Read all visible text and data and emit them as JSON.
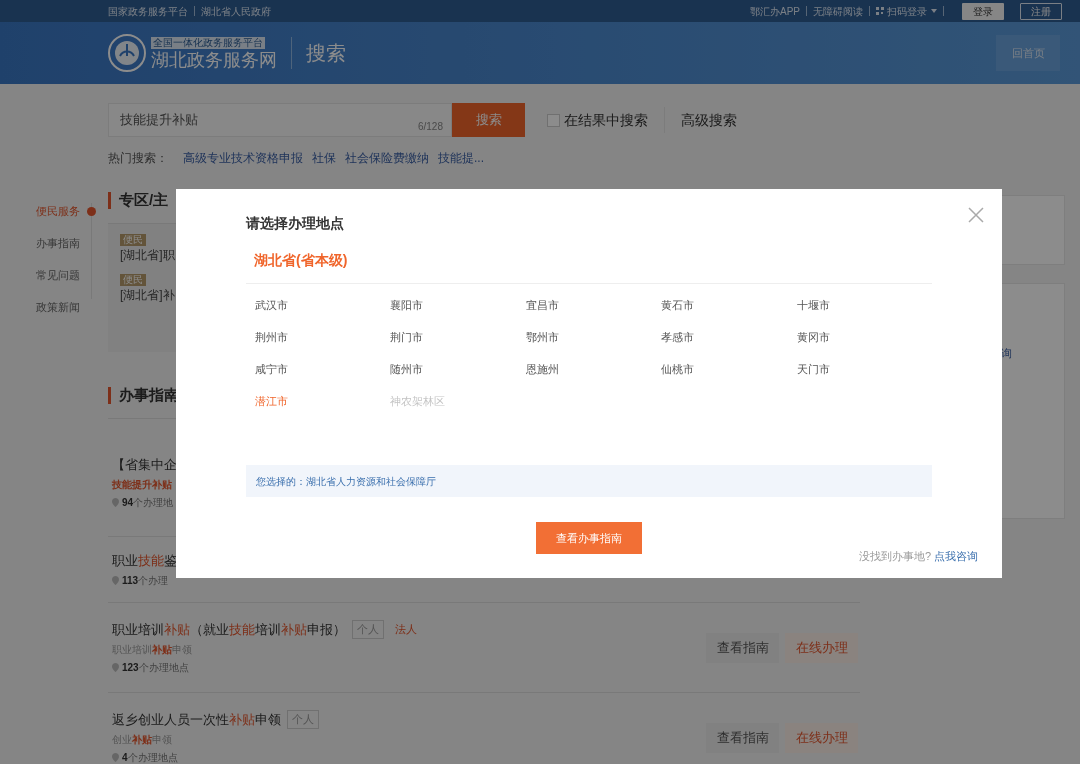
{
  "top_bar": {
    "left_links": [
      "国家政务服务平台",
      "湖北省人民政府"
    ],
    "right_links": [
      "鄂汇办APP",
      "无障碍阅读"
    ],
    "scan_login": "扫码登录",
    "login": "登录",
    "register": "注册"
  },
  "header": {
    "logo_tagline": "全国一体化政务服务平台",
    "logo_title": "湖北政务服务网",
    "page_title": "搜索",
    "home_button": "回首页"
  },
  "search": {
    "value": "技能提升补贴",
    "counter": "6/128",
    "button": "搜索",
    "in_results": {
      "label": "在结果中搜索",
      "checked": false
    },
    "advanced": "高级搜索"
  },
  "hot_search": {
    "label": "热门搜索：",
    "items": [
      "高级专业技术资格申报",
      "社保",
      "社会保险费缴纳",
      "技能提..."
    ]
  },
  "side_nav": [
    {
      "label": "便民服务",
      "selected": true
    },
    {
      "label": "办事指南",
      "selected": false
    },
    {
      "label": "常见问题",
      "selected": false
    },
    {
      "label": "政策新闻",
      "selected": false
    }
  ],
  "zone": {
    "title": "专区/主",
    "items": [
      {
        "tag": "便民",
        "text": "[湖北省]职"
      },
      {
        "tag": "便民",
        "text": "[湖北省]补"
      }
    ]
  },
  "guide": {
    "title": "办事指南",
    "items": [
      {
        "title": "【省集中企",
        "subtitle": "**技能提升补贴**",
        "count": "**94**个办理地"
      },
      {
        "title": "职业**技能**鉴",
        "count": "**113**个办理"
      },
      {
        "title": "职业培训**补贴**（就业**技能**培训**补贴**申报）",
        "tags": [
          {
            "label": "个人",
            "kind": "individual"
          },
          {
            "label": "法人",
            "kind": "legal"
          }
        ],
        "subtitle": "职业培训**补贴**申领",
        "count": "**123**个办理地点",
        "buttons": [
          {
            "label": "查看指南",
            "kind": "plain"
          },
          {
            "label": "在线办理",
            "kind": "accent"
          }
        ]
      },
      {
        "title": "返乡创业人员一次性**补贴**申领",
        "tags": [
          {
            "label": "个人",
            "kind": "individual"
          }
        ],
        "subtitle": "创业**补贴**申领",
        "count": "**4**个办理地点",
        "buttons": [
          {
            "label": "查看指南",
            "kind": "plain"
          },
          {
            "label": "在线办理",
            "kind": "accent"
          }
        ]
      }
    ]
  },
  "right_panel": {
    "text": "询"
  },
  "modal": {
    "title": "请选择办理地点",
    "province": "湖北省(省本级)",
    "cities": [
      {
        "name": "武汉市",
        "selected": false,
        "disabled": false
      },
      {
        "name": "襄阳市",
        "selected": false,
        "disabled": false
      },
      {
        "name": "宜昌市",
        "selected": false,
        "disabled": false
      },
      {
        "name": "黄石市",
        "selected": false,
        "disabled": false
      },
      {
        "name": "十堰市",
        "selected": false,
        "disabled": false
      },
      {
        "name": "荆州市",
        "selected": false,
        "disabled": false
      },
      {
        "name": "荆门市",
        "selected": false,
        "disabled": false
      },
      {
        "name": "鄂州市",
        "selected": false,
        "disabled": false
      },
      {
        "name": "孝感市",
        "selected": false,
        "disabled": false
      },
      {
        "name": "黄冈市",
        "selected": false,
        "disabled": false
      },
      {
        "name": "咸宁市",
        "selected": false,
        "disabled": false
      },
      {
        "name": "随州市",
        "selected": false,
        "disabled": false
      },
      {
        "name": "恩施州",
        "selected": false,
        "disabled": false
      },
      {
        "name": "仙桃市",
        "selected": false,
        "disabled": false
      },
      {
        "name": "天门市",
        "selected": false,
        "disabled": false
      },
      {
        "name": "潜江市",
        "selected": true,
        "disabled": false
      },
      {
        "name": "神农架林区",
        "selected": false,
        "disabled": true
      }
    ],
    "selected_label": "您选择的：",
    "selected_value": "湖北省人力资源和社会保障厅",
    "button": "查看办事指南",
    "footer_text": "没找到办事地?",
    "footer_link": "点我咨询"
  }
}
